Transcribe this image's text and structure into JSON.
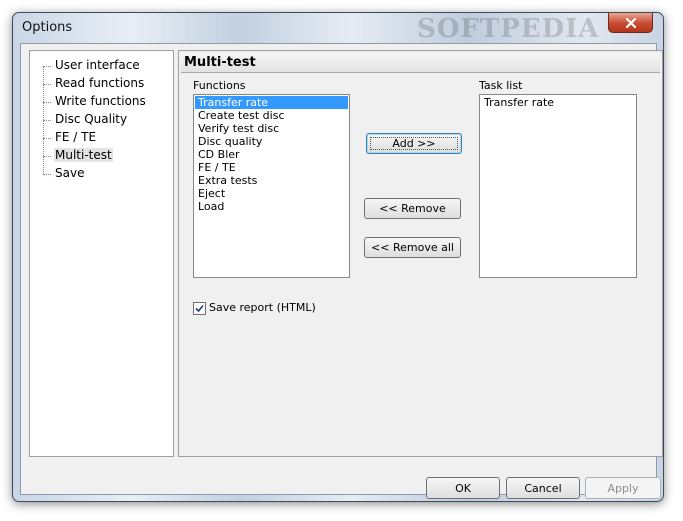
{
  "window": {
    "title": "Options",
    "watermark": "SOFTPEDIA"
  },
  "tree": {
    "items": [
      {
        "label": "User interface"
      },
      {
        "label": "Read functions"
      },
      {
        "label": "Write functions"
      },
      {
        "label": "Disc Quality"
      },
      {
        "label": "FE / TE"
      },
      {
        "label": "Multi-test",
        "selected": true
      },
      {
        "label": "Save"
      }
    ]
  },
  "panel": {
    "title": "Multi-test",
    "functions_label": "Functions",
    "functions": [
      {
        "label": "Transfer rate",
        "selected": true
      },
      {
        "label": "Create test disc"
      },
      {
        "label": "Verify test disc"
      },
      {
        "label": "Disc quality"
      },
      {
        "label": "CD Bler"
      },
      {
        "label": "FE / TE"
      },
      {
        "label": "Extra tests"
      },
      {
        "label": "Eject"
      },
      {
        "label": "Load"
      }
    ],
    "task_list_label": "Task list",
    "task_list": [
      {
        "label": "Transfer rate"
      }
    ],
    "add_label": "Add >>",
    "remove_label": "<< Remove",
    "remove_all_label": "<< Remove all",
    "save_report_label": "Save report (HTML)",
    "save_report_checked": true
  },
  "footer": {
    "ok_label": "OK",
    "cancel_label": "Cancel",
    "apply_label": "Apply"
  },
  "colors": {
    "selection": "#3399ff",
    "close_button": "#c74a32"
  }
}
